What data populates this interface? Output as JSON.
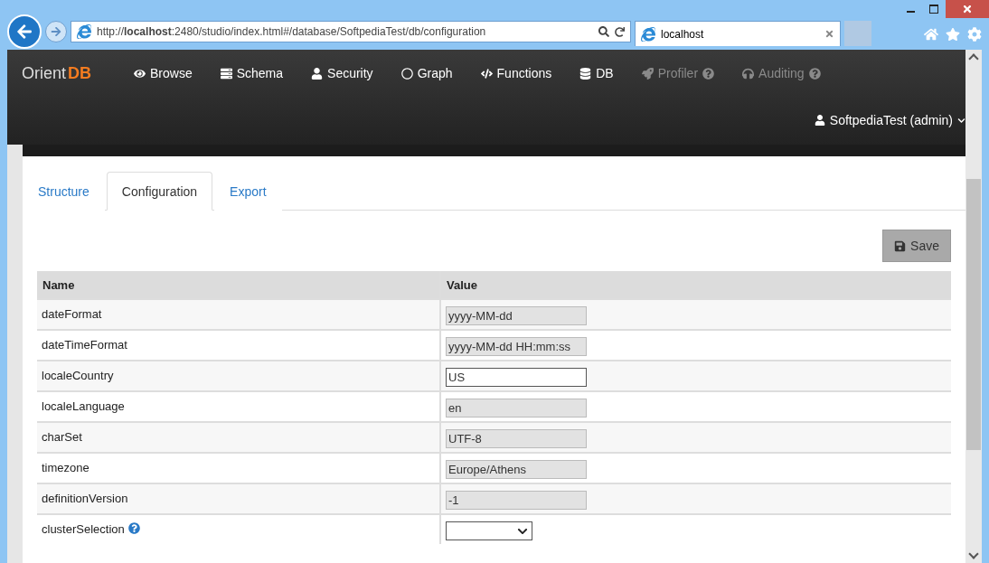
{
  "browser": {
    "address": "http://**localhost**:2480/studio/index.html#/database/SoftpediaTest/db/configuration",
    "tab_title": "localhost"
  },
  "navbar": {
    "logo": {
      "prefix": "Orient",
      "suffix": "DB"
    },
    "items": [
      {
        "label": "Browse",
        "disabled": false
      },
      {
        "label": "Schema",
        "disabled": false
      },
      {
        "label": "Security",
        "disabled": false
      },
      {
        "label": "Graph",
        "disabled": false
      },
      {
        "label": "Functions",
        "disabled": false
      },
      {
        "label": "DB",
        "disabled": false
      },
      {
        "label": "Profiler",
        "disabled": true,
        "help": true
      },
      {
        "label": "Auditing",
        "disabled": true,
        "help": true
      }
    ],
    "user": "SoftpediaTest (admin)"
  },
  "tabs": [
    {
      "label": "Structure",
      "selected": false
    },
    {
      "label": "Configuration",
      "selected": true
    },
    {
      "label": "Export",
      "selected": false
    }
  ],
  "save_button": "Save",
  "table": {
    "columns": [
      "Name",
      "Value"
    ],
    "rows": [
      {
        "name": "dateFormat",
        "kind": "input",
        "value": "yyyy-MM-dd",
        "disabled": true
      },
      {
        "name": "dateTimeFormat",
        "kind": "input",
        "value": "yyyy-MM-dd HH:mm:ss",
        "disabled": true
      },
      {
        "name": "localeCountry",
        "kind": "input",
        "value": "US",
        "disabled": false
      },
      {
        "name": "localeLanguage",
        "kind": "input",
        "value": "en",
        "disabled": true
      },
      {
        "name": "charSet",
        "kind": "input",
        "value": "UTF-8",
        "disabled": true
      },
      {
        "name": "timezone",
        "kind": "input",
        "value": "Europe/Athens",
        "disabled": true
      },
      {
        "name": "definitionVersion",
        "kind": "input",
        "value": "-1",
        "disabled": true
      },
      {
        "name": "clusterSelection",
        "kind": "select",
        "help": true
      }
    ]
  }
}
